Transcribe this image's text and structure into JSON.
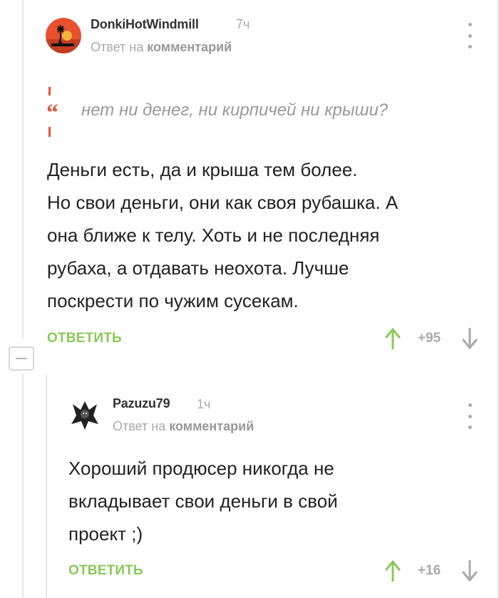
{
  "comments": [
    {
      "author": "DonkiHotWindmill",
      "time": "7ч",
      "reply_prefix": "Ответ на",
      "reply_target": "комментарий",
      "quote": "нет ни денег, ни кирпичей ни крыши?",
      "body_lines": [
        "Деньги есть, да и крыша тем более.",
        "Но свои деньги, они как своя рубашка. А",
        "она ближе к телу. Хоть и не последняя",
        "рубаха, а отдавать неохота. Лучше",
        "поскрести по чужим сусекам."
      ],
      "reply_label": "ОТВЕТИТЬ",
      "score": "+95"
    },
    {
      "author": "Pazuzu79",
      "time": "1ч",
      "reply_prefix": "Ответ на",
      "reply_target": "комментарий",
      "body_lines": [
        "Хороший продюсер никогда не",
        "вкладывает свои деньги в свой",
        "проект ;)"
      ],
      "reply_label": "ОТВЕТИТЬ",
      "score": "+16"
    }
  ],
  "colors": {
    "accent_green": "#8ac858",
    "muted_gray": "#aaaaaa",
    "quote_red": "#e2553a"
  },
  "icons": [
    "collapse-icon",
    "menu-dots-icon",
    "quote-icon",
    "arrow-up-icon",
    "arrow-down-icon"
  ]
}
